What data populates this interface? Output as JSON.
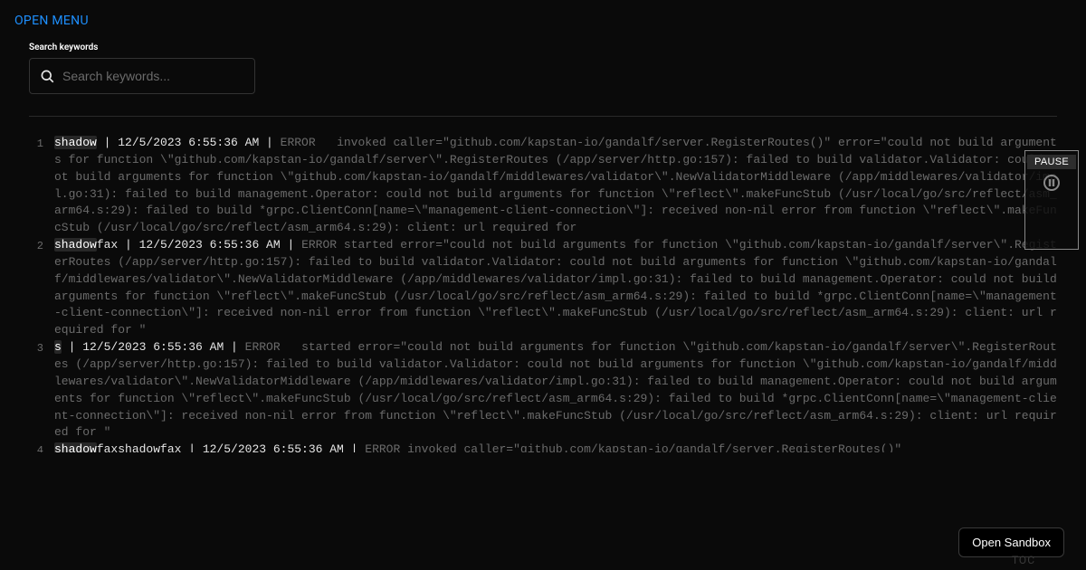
{
  "header": {
    "menu_label": "OPEN MENU"
  },
  "search": {
    "label": "Search keywords",
    "placeholder": "Search keywords..."
  },
  "controls": {
    "pause_label": "PAUSE",
    "sandbox_label": "Open Sandbox",
    "toc_label": "TOC"
  },
  "logs": [
    {
      "n": "1",
      "hl": "shadow",
      "meta_rest": " | 12/5/2023 6:55:36 AM | ",
      "body": "ERROR   invoked caller=\"github.com/kapstan-io/gandalf/server.RegisterRoutes()\" error=\"could not build arguments for function \\\"github.com/kapstan-io/gandalf/server\\\".RegisterRoutes (/app/server/http.go:157): failed to build validator.Validator: could not build arguments for function \\\"github.com/kapstan-io/gandalf/middlewares/validator\\\".NewValidatorMiddleware (/app/middlewares/validator/impl.go:31): failed to build management.Operator: could not build arguments for function \\\"reflect\\\".makeFuncStub (/usr/local/go/src/reflect/asm_arm64.s:29): failed to build *grpc.ClientConn[name=\\\"management-client-connection\\\"]: received non-nil error from function \\\"reflect\\\".makeFuncStub (/usr/local/go/src/reflect/asm_arm64.s:29): client: url required for "
    },
    {
      "n": "2",
      "hl": "shadow",
      "meta_rest": "fax | 12/5/2023 6:55:36 AM | ",
      "body": "ERROR started error=\"could not build arguments for function \\\"github.com/kapstan-io/gandalf/server\\\".RegisterRoutes (/app/server/http.go:157): failed to build validator.Validator: could not build arguments for function \\\"github.com/kapstan-io/gandalf/middlewares/validator\\\".NewValidatorMiddleware (/app/middlewares/validator/impl.go:31): failed to build management.Operator: could not build arguments for function \\\"reflect\\\".makeFuncStub (/usr/local/go/src/reflect/asm_arm64.s:29): failed to build *grpc.ClientConn[name=\\\"management-client-connection\\\"]: received non-nil error from function \\\"reflect\\\".makeFuncStub (/usr/local/go/src/reflect/asm_arm64.s:29): client: url required for \""
    },
    {
      "n": "3",
      "hl": "s",
      "meta_rest": " | 12/5/2023 6:55:36 AM | ",
      "body": "ERROR   started error=\"could not build arguments for function \\\"github.com/kapstan-io/gandalf/server\\\".RegisterRoutes (/app/server/http.go:157): failed to build validator.Validator: could not build arguments for function \\\"github.com/kapstan-io/gandalf/middlewares/validator\\\".NewValidatorMiddleware (/app/middlewares/validator/impl.go:31): failed to build management.Operator: could not build arguments for function \\\"reflect\\\".makeFuncStub (/usr/local/go/src/reflect/asm_arm64.s:29): failed to build *grpc.ClientConn[name=\\\"management-client-connection\\\"]: received non-nil error from function \\\"reflect\\\".makeFuncStub (/usr/local/go/src/reflect/asm_arm64.s:29): client: url required for \""
    },
    {
      "n": "4",
      "hl": "shadow",
      "meta_rest": "faxshadowfax | 12/5/2023 6:55:36 AM | ",
      "body": "ERROR   invoked caller=\"github.com/kapstan-io/gandalf/server.RegisterRoutes()\" "
    }
  ]
}
